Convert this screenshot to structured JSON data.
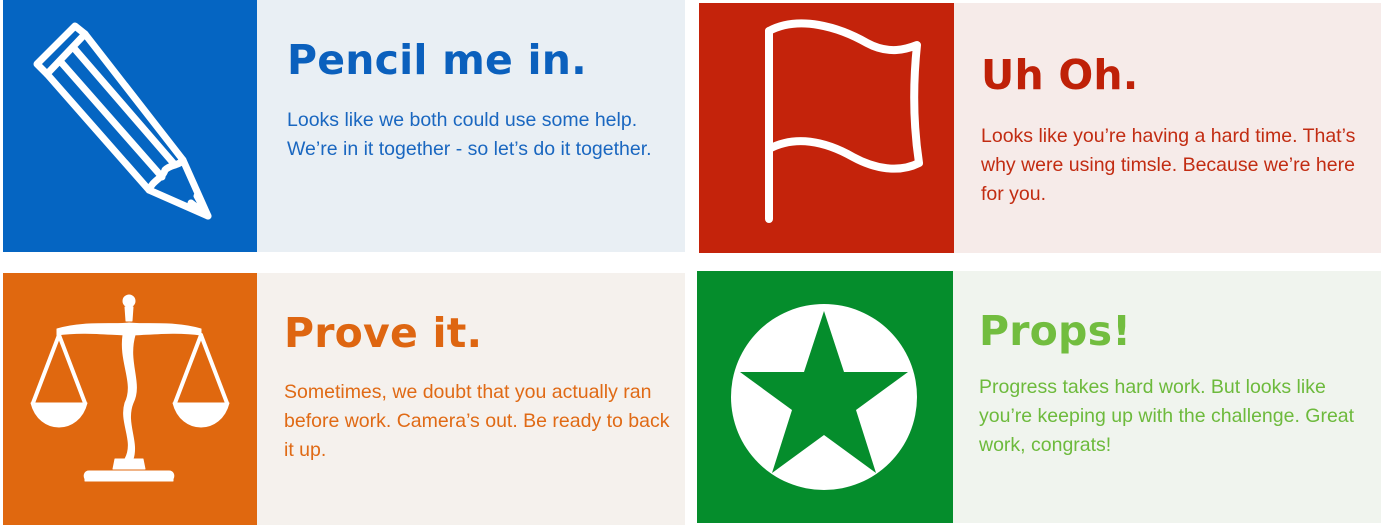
{
  "cards": [
    {
      "icon": "pencil-icon",
      "title": "Pencil me in.",
      "body": "Looks like we both could use some help. We’re in it together - so let’s do it together.",
      "accent": "#0565c2"
    },
    {
      "icon": "flag-icon",
      "title": "Uh Oh.",
      "body": "Looks like you’re having a hard time. That’s why were using timsle. Because we’re here for you.",
      "accent": "#c4230b"
    },
    {
      "icon": "scales-icon",
      "title": "Prove it.",
      "body": "Sometimes, we doubt that you actually ran before work. Camera’s out. Be ready to back it up.",
      "accent": "#e0680f"
    },
    {
      "icon": "star-icon",
      "title": "Props!",
      "body": "Progress takes hard work. But looks like you’re keeping up with the challenge. Great work, congrats!",
      "accent": "#058d2c"
    }
  ]
}
